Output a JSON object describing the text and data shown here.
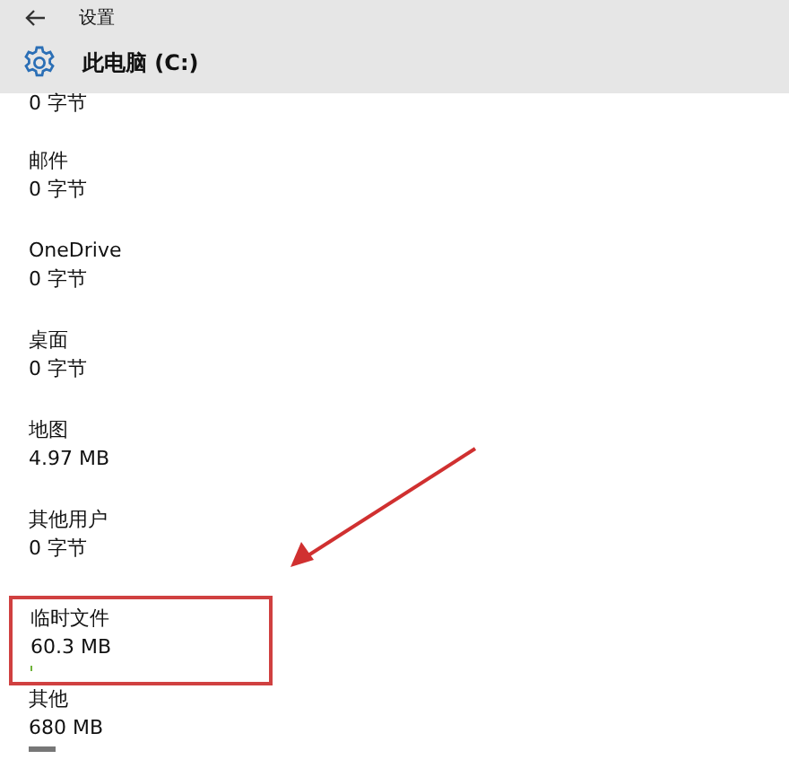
{
  "header": {
    "back_title": "设置",
    "page_title": "此电脑 (C:)"
  },
  "partial_item": {
    "size": "0 字节"
  },
  "items": [
    {
      "kind": "plain",
      "label": "邮件",
      "size": "0 字节",
      "highlighted": false
    },
    {
      "kind": "plain",
      "label": "OneDrive",
      "size": "0 字节",
      "highlighted": false
    },
    {
      "kind": "plain",
      "label": "桌面",
      "size": "0 字节",
      "highlighted": false
    },
    {
      "kind": "plain",
      "label": "地图",
      "size": "4.97 MB",
      "highlighted": false
    },
    {
      "kind": "plain",
      "label": "其他用户",
      "size": "0 字节",
      "highlighted": false
    },
    {
      "kind": "sliver",
      "label": "临时文件",
      "size": "60.3 MB",
      "color": "#6fb33a",
      "highlighted": true
    },
    {
      "kind": "short",
      "label": "其他",
      "size": "680 MB",
      "color": "#777777",
      "highlighted": false
    }
  ]
}
